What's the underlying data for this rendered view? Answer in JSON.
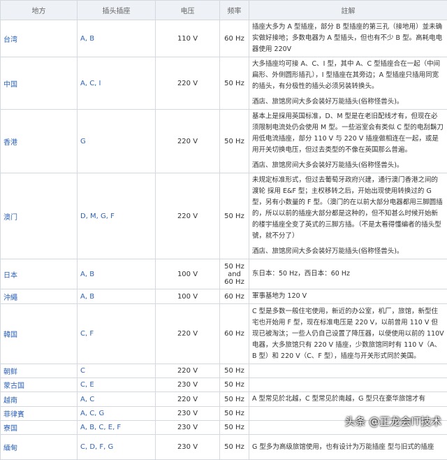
{
  "headers": [
    "地方",
    "插头插座",
    "电压",
    "频率",
    "註解"
  ],
  "rows": [
    {
      "place": "台湾",
      "plugs": "A, B",
      "voltage": "110 V",
      "freq": "60 Hz",
      "notes": [
        "插座大多为 A 型插座，部分 B 型插座的第三孔（接地用）並未确实做好接地；多数电器为 A 型插头，但也有不少 B 型。高耗电电器使用 220V"
      ]
    },
    {
      "place": "中国",
      "plugs": "A, C, I",
      "voltage": "220 V",
      "freq": "50 Hz",
      "notes": [
        "大多插座均可接 A、C、I 型，其中 A、C 型插座合在一起（中间扁形、外侧圆形插孔），I 型插座在其旁边；A 型插座只插用同宽的插头，有分极性的插头必须另装转换头。",
        "酒店、旅馆房间大多会装好万能插头(俗称怪兽头)。"
      ]
    },
    {
      "place": "香港",
      "plugs": "G",
      "voltage": "220 V",
      "freq": "50 Hz",
      "notes": [
        "基本上是採用英国标准，D、M 型是在老旧配线才有，但现在必须限制电流处仍会使用 M 型。一些浴室会有类似 C 型的电刮鬍刀用低电流插座，部分 110 V 与 220 V 插座做相连在一起，或是用开关切换电压，但过去类型的不像在英国那么普遍。",
        "酒店、旅馆房间大多会装好万能插头(俗称怪兽头)。"
      ]
    },
    {
      "place": "澳门",
      "plugs": "D, M, G, F",
      "voltage": "220 V",
      "freq": "50 Hz",
      "notes": [
        "未规定标准形式，但过去葡萄牙政府兴建，通行澳门香港之间的渡轮 採用 E&F 型；主权移转之后，开始出现使用转换过的 G 型，另有小数量的 F 型。（澳门的在以前大部分电器都用三脚圆插的，所以以前的插座大部分都是这种的，但不知甚么时候开始新的楼宇插座全变了英式的三脚方插。（不是太看得懂编者的插头型號，就不分了）",
        "酒店、旅馆房间大多会装好万能插头(俗称怪兽头)。"
      ]
    },
    {
      "place": "日本",
      "plugs": "A, B",
      "voltage": "100 V",
      "freq": "50 Hz and 60 Hz",
      "notes": [
        "东日本：50 Hz，西日本：60 Hz"
      ]
    },
    {
      "place": "沖繩",
      "plugs": "A, B",
      "voltage": "100 V",
      "freq": "60 Hz",
      "notes": [
        "軍事基地为 120 V"
      ]
    },
    {
      "place": "韓国",
      "plugs": "C, F",
      "voltage": "220 V",
      "freq": "60 Hz",
      "notes": [
        "C 型是多数一般住宅使用，新近的办公室，机厂，旅馆，新型住宅也开始用 F 型，现在标准电压是 220 V，以前曾用 110 V 但现已被淘汰；一些人仍自己设置了降压器，以便使用以前的 110V 电器，大多旅馆只有 220 V 插座，少数旅馆同时有 110 V（A、B 型）和 220 V（C、F 型），插座与开关形式同於美国。"
      ]
    },
    {
      "place": "朝鲜",
      "plugs": "C",
      "voltage": "220 V",
      "freq": "50 Hz",
      "notes": []
    },
    {
      "place": "蒙古国",
      "plugs": "C, E",
      "voltage": "230 V",
      "freq": "50 Hz",
      "notes": []
    },
    {
      "place": "越南",
      "plugs": "A, C",
      "voltage": "220 V",
      "freq": "50 Hz",
      "notes": [
        "A 型常见於北越，C 型常见於南越，G 型只在豪华旅馆才有"
      ]
    },
    {
      "place": "菲律賓",
      "plugs": "A, C, G",
      "voltage": "230 V",
      "freq": "50 Hz",
      "notes": []
    },
    {
      "place": "寮国",
      "plugs": "A, B, C, E, F",
      "voltage": "230 V",
      "freq": "50 Hz",
      "notes": []
    },
    {
      "place": "緬甸",
      "plugs": "C, D, F, G",
      "voltage": "230 V",
      "freq": "50 Hz",
      "notes": [
        "G 型多为高级旅馆使用，也有设计为万能插座 型与旧式的插座"
      ]
    }
  ],
  "watermark": "头条 @正龙会IT技术"
}
